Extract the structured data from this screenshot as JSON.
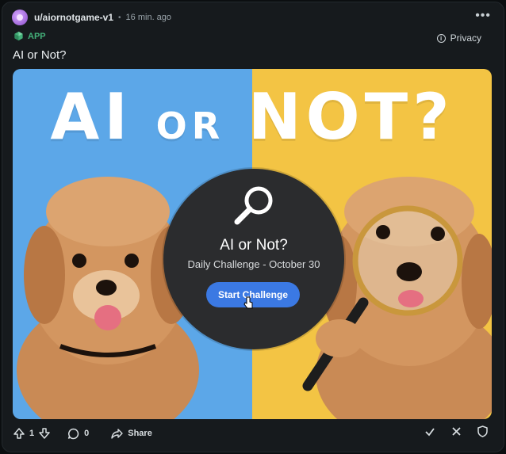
{
  "post": {
    "username": "u/aiornotgame-v1",
    "separator": "•",
    "time": "16 min. ago",
    "more_label": "•••",
    "app_label": "APP",
    "privacy_label": "Privacy",
    "info_glyph": "i",
    "title": "AI or Not?"
  },
  "preview": {
    "banner_left": "AI",
    "banner_mid": "OR",
    "banner_right": "NOT?",
    "left_bg": "#5ca7e8",
    "right_bg": "#f3c444",
    "modal_title": "AI or Not?",
    "modal_subtitle": "Daily Challenge - October 30",
    "start_button": "Start Challenge"
  },
  "footer": {
    "upvote_count": "1",
    "comment_count": "0",
    "share_label": "Share"
  },
  "icons": [
    "upvote-icon",
    "downvote-icon",
    "comment-icon",
    "share-icon",
    "check-icon",
    "close-icon",
    "shield-icon",
    "magnifier-icon",
    "cursor-icon",
    "app-icon",
    "more-icon"
  ],
  "colors": {
    "accent": "#3b79e3",
    "app_green": "#44b07a",
    "card_bg": "#161a1d"
  }
}
